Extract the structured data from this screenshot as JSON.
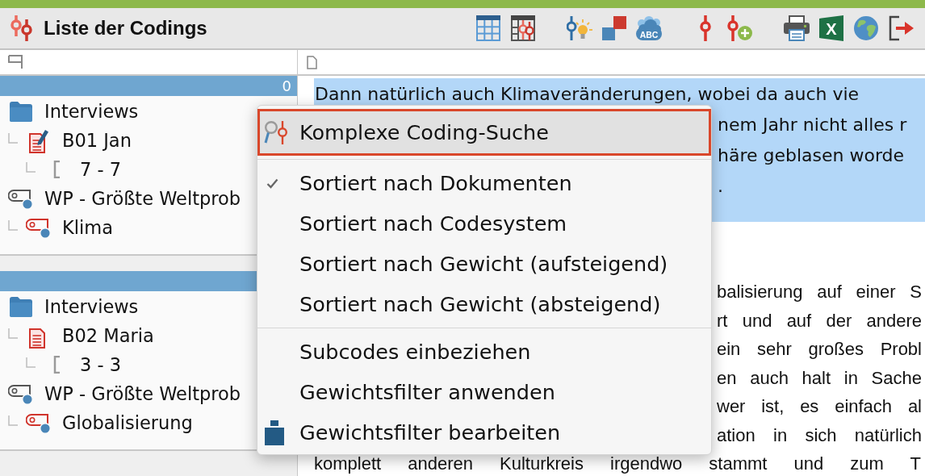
{
  "window": {
    "title": "Liste der Codings"
  },
  "toolbar": {
    "groups": [
      [
        {
          "kind": "table"
        },
        {
          "kind": "overview"
        }
      ],
      [
        {
          "kind": "idea"
        },
        {
          "kind": "duplicate"
        },
        {
          "kind": "cloud",
          "label": "ABC"
        }
      ],
      [
        {
          "kind": "code"
        },
        {
          "kind": "add"
        }
      ],
      [
        {
          "kind": "print"
        },
        {
          "kind": "spreadsheet",
          "label": "X"
        },
        {
          "kind": "web"
        },
        {
          "kind": "exit"
        }
      ]
    ]
  },
  "coding_lists": [
    {
      "count": "0",
      "tree": [
        {
          "kind": "folder",
          "label": "Interviews",
          "children": [
            {
              "kind": "document",
              "label": "B01 Jan",
              "open": true,
              "children": [
                {
                  "kind": "segment",
                  "label": "7 - 7"
                }
              ]
            }
          ]
        },
        {
          "kind": "code",
          "label": "WP - Größte Weltprob",
          "color": "#555555",
          "children": [
            {
              "kind": "code",
              "label": "Klima",
              "color": "#d0342c"
            }
          ]
        }
      ]
    },
    {
      "tree": [
        {
          "kind": "folder",
          "label": "Interviews",
          "children": [
            {
              "kind": "document",
              "label": "B02 Maria",
              "open": false,
              "children": [
                {
                  "kind": "segment",
                  "label": "3 - 3"
                }
              ]
            }
          ]
        },
        {
          "kind": "code",
          "label": "WP - Größte Weltprob",
          "color": "#555555",
          "children": [
            {
              "kind": "code",
              "label": "Globalisierung",
              "color": "#d0342c"
            }
          ]
        }
      ]
    }
  ],
  "document": {
    "paragraphs": [
      {
        "highlighted": true,
        "lines": [
          {
            "text": "Dann natürlich auch Klimaveränderungen, wobei da auch vie",
            "partial": false
          },
          {
            "text": "nem Jahr nicht alles r",
            "partial": true
          },
          {
            "text": "häre geblasen worde",
            "partial": true
          },
          {
            "text": ".",
            "partial": true
          }
        ]
      },
      {
        "highlighted": false,
        "lines": [
          {
            "text": "balisierung auf einer S",
            "partial": true
          },
          {
            "text": "rt und auf der andere",
            "partial": true
          },
          {
            "text": "ein sehr großes Probl",
            "partial": true
          },
          {
            "text": "en auch halt in Sache",
            "partial": true
          },
          {
            "text": "wer ist, es einfach al",
            "partial": true
          },
          {
            "text": "ation in sich natürlich",
            "partial": true
          },
          {
            "text": "komplett anderen Kulturkreis irgendwo stammt und zum T",
            "partial": false
          }
        ]
      }
    ]
  },
  "context_menu": {
    "groups": [
      {
        "items": [
          {
            "kind": "search",
            "label": "Komplexe Coding-Suche",
            "highlighted": true
          }
        ]
      },
      {
        "items": [
          {
            "kind": "option",
            "label": "Sortiert nach Dokumenten",
            "checked": true,
            "highlighted": false
          },
          {
            "kind": "option",
            "label": "Sortiert nach Codesystem",
            "checked": false,
            "highlighted": false
          },
          {
            "kind": "option",
            "label": "Sortiert nach Gewicht (aufsteigend)",
            "checked": false,
            "highlighted": false
          },
          {
            "kind": "option",
            "label": "Sortiert nach Gewicht (absteigend)",
            "checked": false,
            "highlighted": false
          }
        ]
      },
      {
        "items": [
          {
            "kind": "option",
            "label": "Subcodes einbeziehen",
            "checked": false,
            "highlighted": false
          },
          {
            "kind": "option",
            "label": "Gewichtsfilter anwenden",
            "checked": false,
            "highlighted": false
          },
          {
            "kind": "filter",
            "label": "Gewichtsfilter bearbeiten",
            "highlighted": false
          }
        ]
      }
    ]
  }
}
